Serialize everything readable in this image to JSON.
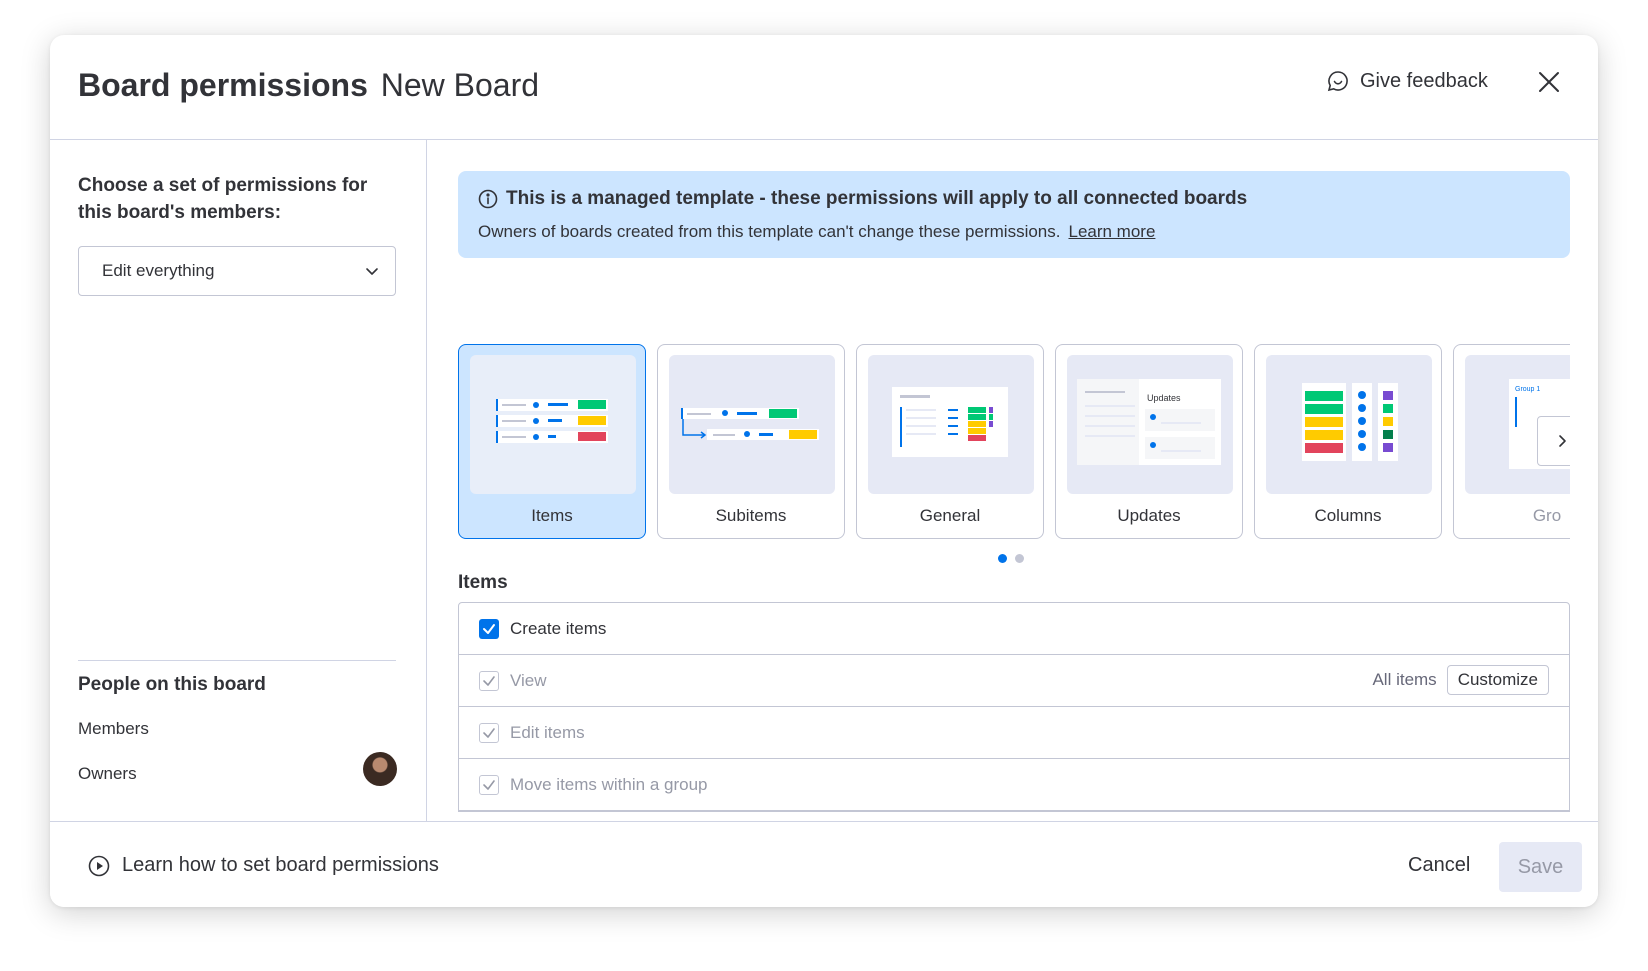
{
  "header": {
    "title_bold": "Board permissions",
    "title_board": "New Board",
    "feedback_label": "Give feedback"
  },
  "sidebar": {
    "choose_label": "Choose a set of permissions for this board's members:",
    "dropdown_value": "Edit everything",
    "people_title": "People on this board",
    "members_label": "Members",
    "owners_label": "Owners"
  },
  "banner": {
    "title": "This is a managed template - these permissions will apply to all connected boards",
    "text": "Owners of boards created from this template can't change these permissions.",
    "link": "Learn more"
  },
  "cards": [
    {
      "label": "Items",
      "selected": true
    },
    {
      "label": "Subitems",
      "selected": false
    },
    {
      "label": "General",
      "selected": false
    },
    {
      "label": "Updates",
      "selected": false
    },
    {
      "label": "Columns",
      "selected": false
    },
    {
      "label": "Gro",
      "selected": false
    }
  ],
  "thumb_text": {
    "updates": "Updates",
    "group": "Group 1"
  },
  "section_title": "Items",
  "permissions": [
    {
      "label": "Create items",
      "checked": true,
      "disabled": false
    },
    {
      "label": "View",
      "checked": true,
      "disabled": true,
      "scope": "All items",
      "action": "Customize"
    },
    {
      "label": "Edit items",
      "checked": true,
      "disabled": true
    },
    {
      "label": "Move items within a group",
      "checked": true,
      "disabled": true
    }
  ],
  "footer": {
    "learn_label": "Learn how to set board permissions",
    "cancel_label": "Cancel",
    "save_label": "Save"
  },
  "colors": {
    "accent": "#0073ea",
    "banner_bg": "#cce5ff",
    "green": "#00c875",
    "yellow": "#ffcb00",
    "red": "#e2445c",
    "purple": "#784bd1"
  }
}
